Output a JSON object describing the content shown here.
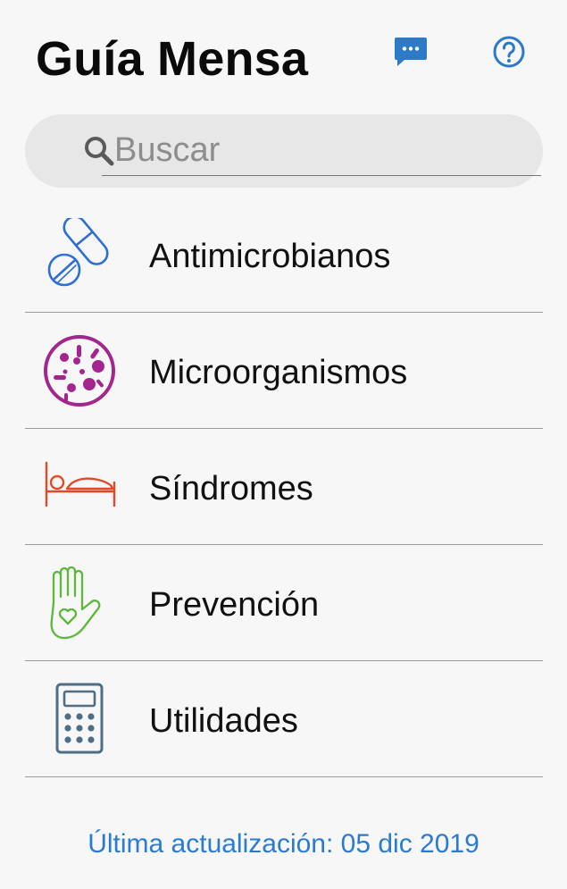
{
  "header": {
    "title": "Guía Mensa",
    "chat_icon": "chat-bubble-icon",
    "help_icon": "help-circle-icon",
    "accent_color": "#2d7ac9"
  },
  "search": {
    "placeholder": "Buscar",
    "value": "",
    "icon": "search-icon"
  },
  "menu": {
    "items": [
      {
        "label": "Antimicrobianos",
        "icon": "pills-icon",
        "color": "#2d6fd2"
      },
      {
        "label": "Microorganismos",
        "icon": "petri-dish-icon",
        "color": "#a3268e"
      },
      {
        "label": "Síndromes",
        "icon": "hospital-bed-icon",
        "color": "#e04a2a"
      },
      {
        "label": "Prevención",
        "icon": "hand-heart-icon",
        "color": "#5cb83b"
      },
      {
        "label": "Utilidades",
        "icon": "calculator-icon",
        "color": "#4f6e86"
      }
    ]
  },
  "footer": {
    "last_update": "Última actualización: 05 dic 2019",
    "color": "#2a7bd1"
  }
}
